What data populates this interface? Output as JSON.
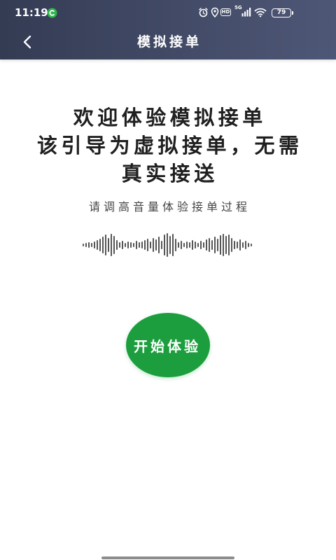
{
  "status_bar": {
    "time": "11:19",
    "hd_label": "HD",
    "network_label": "5G",
    "battery_level": "79",
    "icons": [
      "app-notification-icon",
      "alarm-icon",
      "location-icon",
      "hd-icon",
      "signal-5g-icon",
      "wifi-icon",
      "battery-icon"
    ]
  },
  "header": {
    "title": "模拟接单",
    "back_icon": "chevron-left-icon"
  },
  "intro": {
    "lines": [
      "欢迎体验模拟接单",
      "该引导为虚拟接单，无需",
      "真实接送"
    ],
    "hint": "请调高音量体验接单过程"
  },
  "waveform": {
    "icon": "audio-waveform-icon"
  },
  "start_button": {
    "label": "开始体验"
  },
  "colors": {
    "header_bg_start": "#343c54",
    "header_bg_end": "#4e5776",
    "accent_green": "#1c9e3e",
    "text_primary": "#1f1f1f",
    "text_secondary": "#444444",
    "waveform": "#555555"
  }
}
